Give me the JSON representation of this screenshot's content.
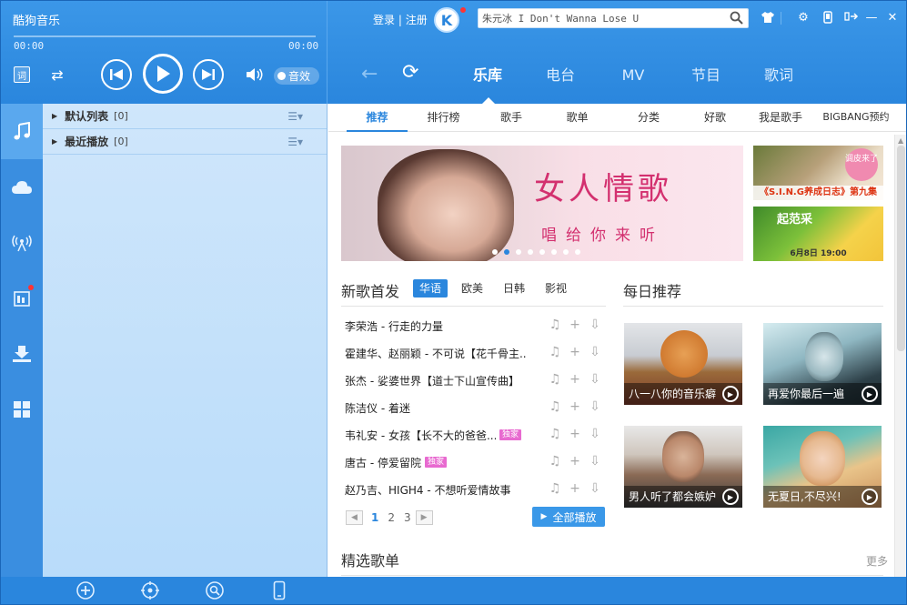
{
  "app": {
    "title": "酷狗音乐"
  },
  "player": {
    "time_current": "00:00",
    "time_total": "00:00",
    "lyric_label": "词",
    "effect_label": "音效"
  },
  "account": {
    "login": "登录",
    "register": "注册",
    "separator": "|"
  },
  "search": {
    "value": "朱元冰 I Don't Wanna Lose U"
  },
  "main_tabs": [
    {
      "label": "乐库",
      "active": true
    },
    {
      "label": "电台",
      "active": false
    },
    {
      "label": "MV",
      "active": false
    },
    {
      "label": "节目",
      "active": false
    },
    {
      "label": "歌词",
      "active": false
    }
  ],
  "playlists": [
    {
      "name": "默认列表",
      "count": "[0]"
    },
    {
      "name": "最近播放",
      "count": "[0]"
    }
  ],
  "sub_tabs": [
    "推荐",
    "排行榜",
    "歌手",
    "歌单",
    "分类",
    "好歌",
    "我是歌手",
    "BIGBANG预约"
  ],
  "banner": {
    "title": "女人情歌",
    "subtitle": "唱给你来听",
    "slides": 8,
    "active_slide": 2
  },
  "side_thumbs": [
    {
      "caption": "《S.I.N.G养成日志》第九集",
      "badge": "调皮来了"
    },
    {
      "caption": "6月8日 19:00",
      "badge": "起范采"
    }
  ],
  "new_songs": {
    "title": "新歌首发",
    "tabs": [
      {
        "label": "华语",
        "active": true
      },
      {
        "label": "欧美",
        "active": false
      },
      {
        "label": "日韩",
        "active": false
      },
      {
        "label": "影视",
        "active": false
      }
    ],
    "songs": [
      {
        "name": "李荣浩 - 行走的力量",
        "tag": ""
      },
      {
        "name": "霍建华、赵丽颖 - 不可说【花千骨主...",
        "tag": ""
      },
      {
        "name": "张杰 - 娑婆世界【道士下山宣传曲】",
        "tag": ""
      },
      {
        "name": "陈洁仪 - 着迷",
        "tag": ""
      },
      {
        "name": "韦礼安 - 女孩【长不大的爸爸...",
        "tag": "独家"
      },
      {
        "name": "唐古 - 停爱留院",
        "tag": "独家"
      },
      {
        "name": "赵乃吉、HIGH4 - 不想听爱情故事",
        "tag": ""
      }
    ],
    "pages": [
      "1",
      "2",
      "3"
    ],
    "current_page": "1",
    "play_all": "全部播放"
  },
  "daily": {
    "title": "每日推荐",
    "cards": [
      {
        "caption": "八一八你的音乐癖"
      },
      {
        "caption": "再爱你最后一遍"
      },
      {
        "caption": "男人听了都会嫉妒"
      },
      {
        "caption": "无夏日,不尽兴!"
      }
    ]
  },
  "featured": {
    "title": "精选歌单",
    "more": "更多"
  },
  "colors": {
    "accent": "#2a86dd",
    "topbar": "#3b97e8",
    "panel": "#cfe6fb",
    "banner_text": "#d3306f",
    "exclusive_tag": "#e86ad0"
  }
}
